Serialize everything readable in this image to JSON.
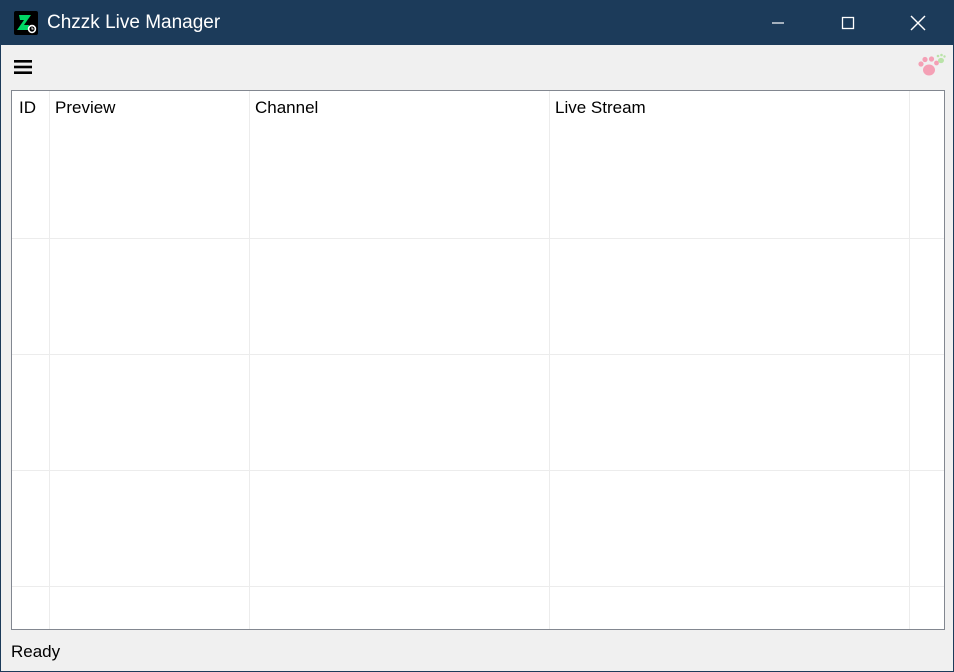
{
  "window": {
    "title": "Chzzk Live Manager",
    "icon": "chzzk-app-icon",
    "controls": {
      "minimize": "minimize-icon",
      "maximize": "maximize-icon",
      "close": "close-icon"
    }
  },
  "toolbar": {
    "menu_icon": "hamburger-menu-icon",
    "logo_icon": "paw-icon"
  },
  "table": {
    "columns": [
      "ID",
      "Preview",
      "Channel",
      "Live Stream"
    ],
    "rows": []
  },
  "status": {
    "text": "Ready"
  },
  "colors": {
    "titlebar": "#1c3b5a",
    "app_icon_accent": "#00d564",
    "paw_pink": "#f4a0b5",
    "paw_green": "#b9e3a8"
  }
}
